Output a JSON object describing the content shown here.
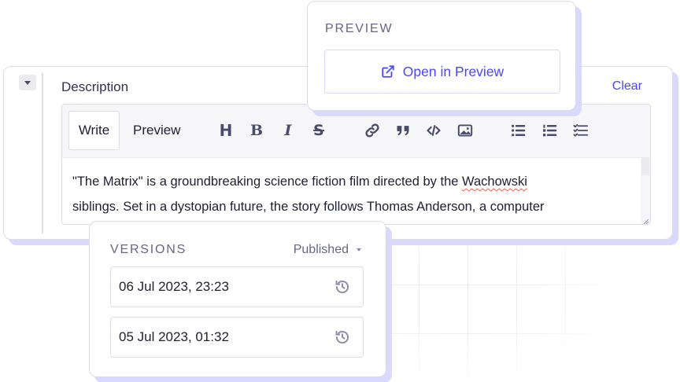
{
  "description_field": {
    "label": "Description",
    "clear_label": "Clear",
    "tabs": {
      "write": "Write",
      "preview": "Preview"
    },
    "toolbar_icons": {
      "heading": "H",
      "bold": "B",
      "italic": "I",
      "strikethrough": "S"
    },
    "content_lines": [
      "\"The Matrix\" is a groundbreaking science fiction film directed by the ",
      "Wachowski",
      "siblings. Set in a dystopian future, the story follows Thomas Anderson, a computer"
    ]
  },
  "preview_panel": {
    "title": "PREVIEW",
    "button_label": "Open in Preview"
  },
  "versions_panel": {
    "title": "VERSIONS",
    "status_selected": "Published",
    "items": [
      {
        "timestamp": "06 Jul 2023, 23:23"
      },
      {
        "timestamp": "05 Jul 2023, 01:32"
      }
    ]
  },
  "colors": {
    "accent": "#4945ff",
    "shadow": "#d9d8ff",
    "border": "#dcdce4",
    "muted_text": "#666687"
  }
}
